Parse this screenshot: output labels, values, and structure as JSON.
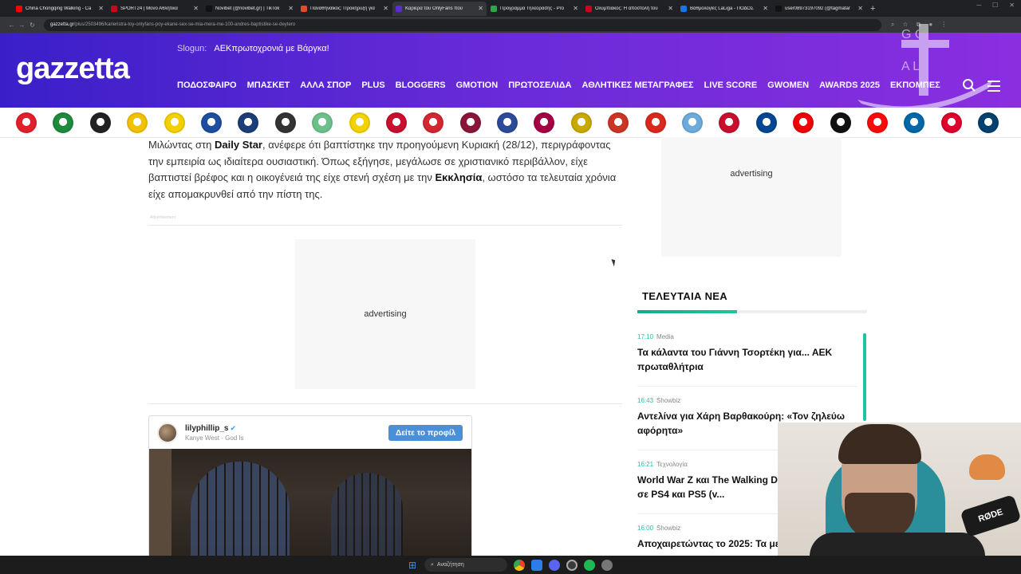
{
  "browser": {
    "tabs": [
      {
        "title": "China Chongqing Walking - Ca",
        "favicon_color": "#ff0000",
        "active": false
      },
      {
        "title": "SPORT24 | Μόνο Αθλητικά",
        "favicon_color": "#d0021b",
        "active": false
      },
      {
        "title": "Novibet (@novibet.gr) | TikTok",
        "favicon_color": "#111111",
        "active": false
      },
      {
        "title": "Παναθηναϊκός: Προκήρυξη για",
        "favicon_color": "#e04b2e",
        "active": false
      },
      {
        "title": "Καριέρα του OnlyFans που",
        "favicon_color": "#5b2bd6",
        "active": true
      },
      {
        "title": "Προγραμμα Τηλεορασης - Pro",
        "favicon_color": "#2aa84a",
        "active": false
      },
      {
        "title": "Ολυμπιακός: Η αποστολή του",
        "favicon_color": "#d0021b",
        "active": false
      },
      {
        "title": "Βαθμολογίες LaLiga - ΠΟΔΟΣ",
        "favicon_color": "#1a73e8",
        "active": false
      },
      {
        "title": "user08973197092 (@tagmatar",
        "favicon_color": "#111111",
        "active": false
      }
    ],
    "url_host": "gazzetta.gr",
    "url_path": "/plus/2503496/karieristra-toy-onlyfans-poy-ekane-sex-se-mia-mera-me-100-andres-baptistike-se-deytero"
  },
  "site": {
    "logo": "gazzetta",
    "slogan_label": "Slogun:",
    "slogan_text": "ΑΕΚπρωτοχρονιά με Βάργκα!",
    "nav": [
      "ΠΟΔΟΣΦΑΙΡΟ",
      "ΜΠΑΣΚΕΤ",
      "ΑΛΛΑ ΣΠΟΡ",
      "PLUS",
      "BLOGGERS",
      "GMOTION",
      "ΠΡΩΤΟΣΕΛΙΔΑ",
      "ΑΘΛΗΤΙΚΕΣ ΜΕΤΑΓΡΑΦΕΣ",
      "LIVE SCORE",
      "GWOMEN",
      "AWARDS 2025",
      "ΕΚΠΟΜΠΕΣ"
    ],
    "watermark": "GOAL UCAS"
  },
  "clubs": [
    {
      "name": "olympiacos",
      "color": "#e0202a"
    },
    {
      "name": "panathinaikos",
      "color": "#1e8a3c"
    },
    {
      "name": "paok",
      "color": "#222222"
    },
    {
      "name": "aek",
      "color": "#f2c200"
    },
    {
      "name": "aris",
      "color": "#f4d000"
    },
    {
      "name": "atromitos",
      "color": "#1c4fa0"
    },
    {
      "name": "asteras",
      "color": "#1d3d7a"
    },
    {
      "name": "ofi",
      "color": "#333333"
    },
    {
      "name": "levadiakos",
      "color": "#6cc08a"
    },
    {
      "name": "panetolikos",
      "color": "#f2d200"
    },
    {
      "name": "volos",
      "color": "#c8102e"
    },
    {
      "name": "larisa",
      "color": "#d22630"
    },
    {
      "name": "kifisia",
      "color": "#8a1538"
    },
    {
      "name": "panserraikos",
      "color": "#2c4b9a"
    },
    {
      "name": "barcelona",
      "color": "#a50044"
    },
    {
      "name": "real-madrid",
      "color": "#c9a800"
    },
    {
      "name": "atletico",
      "color": "#cb3524"
    },
    {
      "name": "man-utd",
      "color": "#da291c"
    },
    {
      "name": "man-city",
      "color": "#6cabdd"
    },
    {
      "name": "liverpool",
      "color": "#c8102e"
    },
    {
      "name": "chelsea",
      "color": "#034694"
    },
    {
      "name": "arsenal",
      "color": "#ef0107"
    },
    {
      "name": "juventus",
      "color": "#111111"
    },
    {
      "name": "milan",
      "color": "#fb090b"
    },
    {
      "name": "inter",
      "color": "#0068a8"
    },
    {
      "name": "bayern",
      "color": "#dc052d"
    },
    {
      "name": "psg",
      "color": "#004170"
    }
  ],
  "article": {
    "p_start": "Μιλώντας στη ",
    "p_bold1": "Daily Star",
    "p_mid": ", ανέφερε ότι βαπτίστηκε την προηγούμενη Κυριακή (28/12), περιγράφοντας την εμπειρία ως ιδιαίτερα ουσιαστική. Όπως εξήγησε, μεγάλωσε σε χριστιανικό περιβάλλον, είχε βαπτιστεί βρέφος και η οικογένειά της είχε στενή σχέση με την ",
    "p_bold2": "Εκκλησία",
    "p_end": ", ωστόσο τα τελευταία χρόνια είχε απομακρυνθεί από την πίστη της.",
    "ad_small_label": "Advertisement",
    "ad_label": "advertising"
  },
  "instagram": {
    "username": "lilyphillip_s",
    "song": "Kanye West · God Is",
    "follow_label": "Δείτε το προφίλ"
  },
  "sidebar": {
    "ad_label": "advertising",
    "latest_title": "ΤΕΛΕΥΤΑΙΑ ΝΕΑ",
    "news": [
      {
        "time": "17:10",
        "category": "Media",
        "headline": "Τα κάλαντα του Γιάννη Τσορτέκη για... ΑΕΚ πρωταθλήτρια"
      },
      {
        "time": "16:43",
        "category": "Showbiz",
        "headline": "Αντελίνα για Χάρη Βαρθακούρη: «Τον ζηλεύω αφόρητα»"
      },
      {
        "time": "16:21",
        "category": "Τεχνολογία",
        "headline": "World War Z και The Walking D... τον Ιανουάριο σε PS4 και PS5 (v..."
      },
      {
        "time": "16:00",
        "category": "Showbiz",
        "headline": "Αποχαιρετώντας το 2025: Τα μεγ..."
      }
    ]
  },
  "webcam": {
    "mic_brand": "RØDE"
  },
  "taskbar": {
    "search_label": "Αναζήτηση"
  }
}
